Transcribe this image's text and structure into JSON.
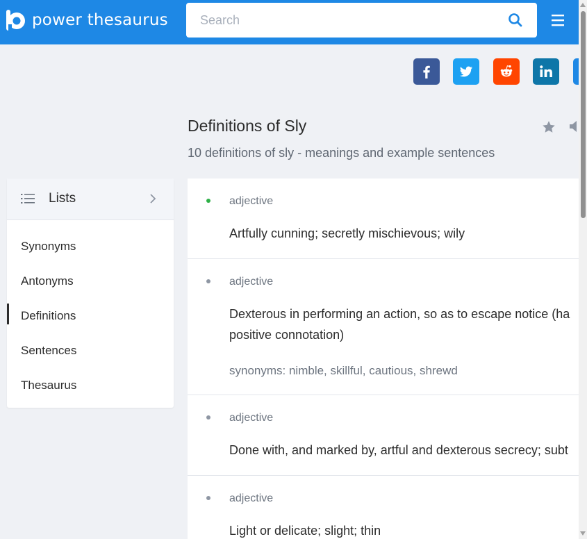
{
  "header": {
    "logo_text": "power thesaurus",
    "search_placeholder": "Search",
    "search_value": "",
    "brand_color": "#1e88e5"
  },
  "social": [
    {
      "name": "facebook",
      "color": "#3b5998"
    },
    {
      "name": "twitter",
      "color": "#1da1f2"
    },
    {
      "name": "reddit",
      "color": "#ff4500"
    },
    {
      "name": "linkedin",
      "color": "#0e76a8"
    }
  ],
  "page": {
    "title": "Definitions of Sly",
    "subtitle": "10 definitions of sly - meanings and example sentences"
  },
  "sidebar": {
    "header_label": "Lists",
    "items": [
      {
        "label": "Synonyms",
        "active": false
      },
      {
        "label": "Antonyms",
        "active": false
      },
      {
        "label": "Definitions",
        "active": true
      },
      {
        "label": "Sentences",
        "active": false
      },
      {
        "label": "Thesaurus",
        "active": false
      }
    ]
  },
  "definitions": [
    {
      "pos": "adjective",
      "text_lines": [
        "Artfully cunning; secretly mischievous; wily"
      ],
      "synonyms": "",
      "highlight": true
    },
    {
      "pos": "adjective",
      "text_lines": [
        "Dexterous in performing an action, so as to escape notice (ha",
        "positive connotation)"
      ],
      "synonyms": "synonyms: nimble, skillful, cautious, shrewd",
      "highlight": false
    },
    {
      "pos": "adjective",
      "text_lines": [
        "Done with, and marked by, artful and dexterous secrecy; subt"
      ],
      "synonyms": "",
      "highlight": false
    },
    {
      "pos": "adjective",
      "text_lines": [
        "Light or delicate; slight; thin"
      ],
      "synonyms": "",
      "highlight": false
    }
  ]
}
